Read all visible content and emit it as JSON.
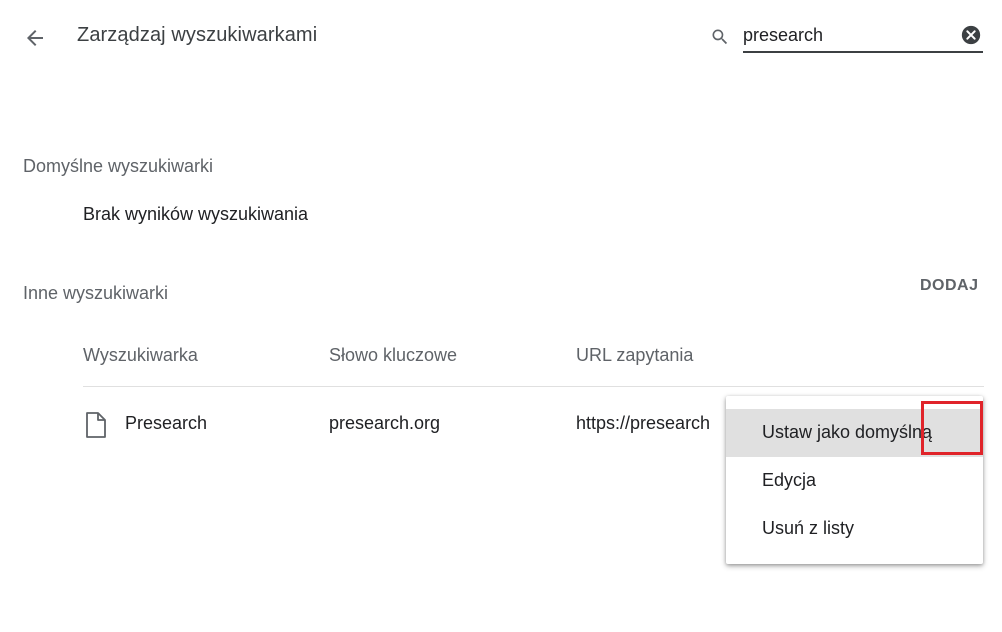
{
  "header": {
    "title": "Zarządzaj wyszukiwarkami",
    "search_value": "presearch"
  },
  "default_section": {
    "title": "Domyślne wyszukiwarki",
    "empty_text": "Brak wyników wyszukiwania"
  },
  "other_section": {
    "title": "Inne wyszukiwarki",
    "add_label": "DODAJ",
    "columns": [
      "Wyszukiwarka",
      "Słowo kluczowe",
      "URL zapytania"
    ],
    "rows": [
      {
        "name": "Presearch",
        "keyword": "presearch.org",
        "url": "https://presearch"
      }
    ]
  },
  "context_menu": {
    "items": [
      "Ustaw jako domyślną",
      "Edycja",
      "Usuń z listy"
    ]
  },
  "icons": [
    "back-arrow-icon",
    "search-icon",
    "clear-icon",
    "document-icon"
  ],
  "colors": {
    "highlight": "#e0242a",
    "hover": "#e0e0e0"
  }
}
